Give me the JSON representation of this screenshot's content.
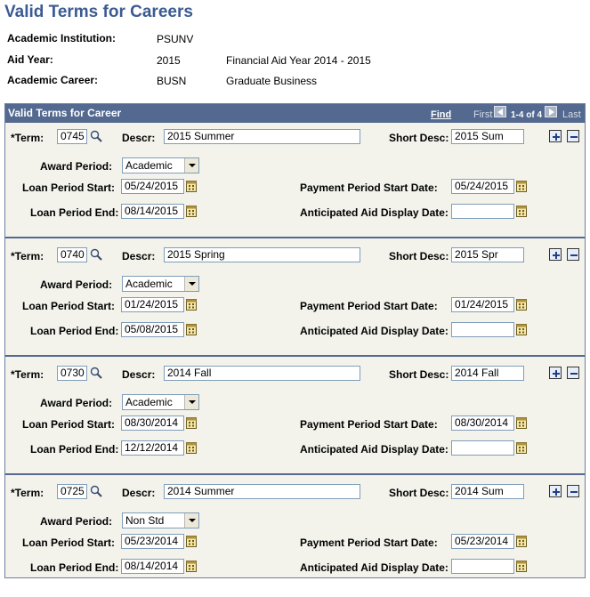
{
  "page": {
    "title": "Valid Terms for Careers"
  },
  "header": {
    "institution_label": "Academic Institution:",
    "institution_value": "PSUNV",
    "aid_year_label": "Aid Year:",
    "aid_year_value": "2015",
    "aid_year_desc": "Financial Aid Year 2014 - 2015",
    "career_label": "Academic Career:",
    "career_value": "BUSN",
    "career_desc": "Graduate Business"
  },
  "grid": {
    "title": "Valid Terms for Career",
    "find": "Find",
    "first": "First",
    "count": "1-4 of 4",
    "last": "Last"
  },
  "labels": {
    "term": "*Term:",
    "descr": "Descr:",
    "short_desc": "Short Desc:",
    "award_period": "Award Period:",
    "loan_start": "Loan Period Start:",
    "loan_end": "Loan Period End:",
    "payment_start": "Payment Period Start Date:",
    "anticipated": "Anticipated Aid Display Date:"
  },
  "rows": [
    {
      "term": "0745",
      "descr": "2015 Summer",
      "short_desc": "2015 Sum",
      "award_period": "Academic",
      "loan_start": "05/24/2015",
      "loan_end": "08/14/2015",
      "payment_start": "05/24/2015",
      "anticipated": ""
    },
    {
      "term": "0740",
      "descr": "2015 Spring",
      "short_desc": "2015 Spr",
      "award_period": "Academic",
      "loan_start": "01/24/2015",
      "loan_end": "05/08/2015",
      "payment_start": "01/24/2015",
      "anticipated": ""
    },
    {
      "term": "0730",
      "descr": "2014 Fall",
      "short_desc": "2014 Fall",
      "award_period": "Academic",
      "loan_start": "08/30/2014",
      "loan_end": "12/12/2014",
      "payment_start": "08/30/2014",
      "anticipated": ""
    },
    {
      "term": "0725",
      "descr": "2014 Summer",
      "short_desc": "2014 Sum",
      "award_period": "Non Std",
      "loan_start": "05/23/2014",
      "loan_end": "08/14/2014",
      "payment_start": "05/23/2014",
      "anticipated": ""
    }
  ],
  "icons": {
    "lookup": "magnifier-icon",
    "calendar": "calendar-icon",
    "add": "plus-icon",
    "delete": "minus-icon",
    "previous": "arrow-left-icon",
    "next": "arrow-right-icon"
  },
  "colors": {
    "title": "#3b5b92",
    "grid_header": "#53698f",
    "grid_bg": "#f3f3ec"
  }
}
